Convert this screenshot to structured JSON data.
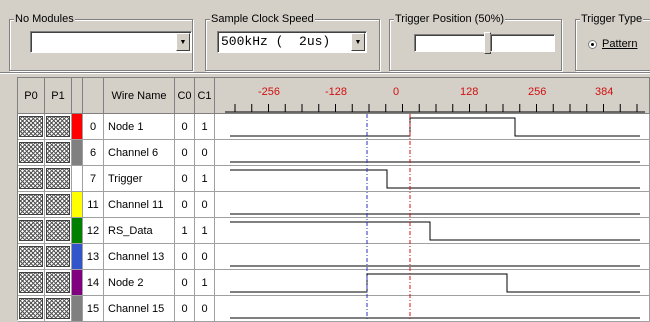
{
  "toolbar": {
    "modules": {
      "label": "No Modules",
      "value": ""
    },
    "clock": {
      "label": "Sample Clock Speed",
      "value": "500kHz (  2us)"
    },
    "trigger_position": {
      "label": "Trigger Position (50%)"
    },
    "trigger_type": {
      "label": "Trigger Type",
      "option": "Pattern"
    }
  },
  "table": {
    "headers": {
      "p0": "P0",
      "p1": "P1",
      "wire_name": "Wire Name",
      "c0": "C0",
      "c1": "C1"
    },
    "scale_ticks": [
      "-256",
      "-128",
      "0",
      "128",
      "256",
      "384"
    ],
    "rows": [
      {
        "idx": "0",
        "name": "Node 1",
        "c0": "0",
        "c1": "1",
        "color": "#ff0000"
      },
      {
        "idx": "6",
        "name": "Channel 6",
        "c0": "0",
        "c1": "0",
        "color": "#808080"
      },
      {
        "idx": "7",
        "name": "Trigger",
        "c0": "0",
        "c1": "1",
        "color": "#ffffff"
      },
      {
        "idx": "11",
        "name": "Channel 11",
        "c0": "0",
        "c1": "0",
        "color": "#ffff00"
      },
      {
        "idx": "12",
        "name": "RS_Data",
        "c0": "1",
        "c1": "1",
        "color": "#008000"
      },
      {
        "idx": "13",
        "name": "Channel 13",
        "c0": "0",
        "c1": "0",
        "color": "#3355cc"
      },
      {
        "idx": "14",
        "name": "Node 2",
        "c0": "0",
        "c1": "1",
        "color": "#800080"
      },
      {
        "idx": "15",
        "name": "Channel 15",
        "c0": "0",
        "c1": "0",
        "color": "#808080"
      }
    ]
  },
  "colors": {
    "cursor_c0": "#3030c0",
    "cursor_c1": "#d01010",
    "scale_text": "#d01010"
  }
}
